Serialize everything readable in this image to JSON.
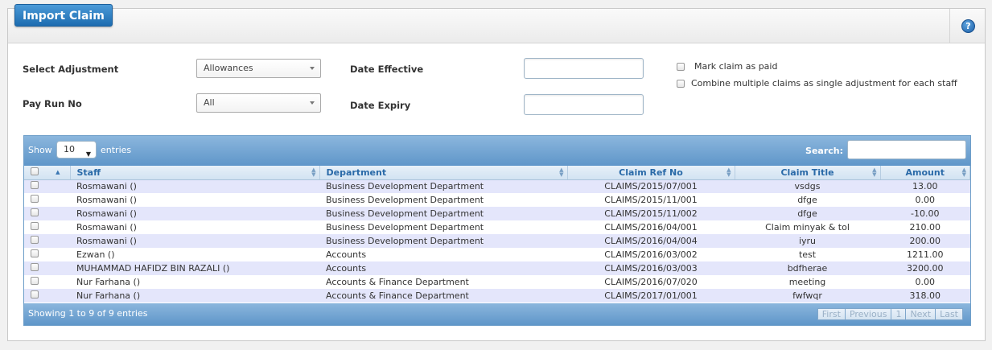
{
  "panel": {
    "title": "Import Claim",
    "help_icon": "?"
  },
  "form": {
    "select_adjustment": {
      "label": "Select Adjustment",
      "value": "Allowances"
    },
    "pay_run_no": {
      "label": "Pay Run No",
      "value": "All"
    },
    "date_effective": {
      "label": "Date Effective",
      "value": ""
    },
    "date_expiry": {
      "label": "Date Expiry",
      "value": ""
    },
    "mark_paid": {
      "label": "Mark claim as paid"
    },
    "combine": {
      "label": "Combine multiple claims as single adjustment for each staff"
    }
  },
  "table": {
    "show_label": "Show",
    "entries_label": "entries",
    "length_value": "10",
    "search_label": "Search:",
    "columns": {
      "staff": "Staff",
      "department": "Department",
      "ref": "Claim Ref No",
      "title": "Claim Title",
      "amount": "Amount"
    },
    "rows": [
      {
        "staff": "Rosmawani ()",
        "department": "Business Development Department",
        "ref": "CLAIMS/2015/07/001",
        "title": "vsdgs",
        "amount": "13.00"
      },
      {
        "staff": "Rosmawani ()",
        "department": "Business Development Department",
        "ref": "CLAIMS/2015/11/001",
        "title": "dfge",
        "amount": "0.00"
      },
      {
        "staff": "Rosmawani ()",
        "department": "Business Development Department",
        "ref": "CLAIMS/2015/11/002",
        "title": "dfge",
        "amount": "-10.00"
      },
      {
        "staff": "Rosmawani ()",
        "department": "Business Development Department",
        "ref": "CLAIMS/2016/04/001",
        "title": "Claim minyak & tol",
        "amount": "210.00"
      },
      {
        "staff": "Rosmawani ()",
        "department": "Business Development Department",
        "ref": "CLAIMS/2016/04/004",
        "title": "iyru",
        "amount": "200.00"
      },
      {
        "staff": "Ezwan ()",
        "department": "Accounts",
        "ref": "CLAIMS/2016/03/002",
        "title": "test",
        "amount": "1211.00"
      },
      {
        "staff": "MUHAMMAD HAFIDZ BIN RAZALI ()",
        "department": "Accounts",
        "ref": "CLAIMS/2016/03/003",
        "title": "bdfherae",
        "amount": "3200.00"
      },
      {
        "staff": "Nur Farhana ()",
        "department": "Accounts & Finance Department",
        "ref": "CLAIMS/2016/07/020",
        "title": "meeting",
        "amount": "0.00"
      },
      {
        "staff": "Nur Farhana ()",
        "department": "Accounts & Finance Department",
        "ref": "CLAIMS/2017/01/001",
        "title": "fwfwqr",
        "amount": "318.00"
      }
    ],
    "info": "Showing 1 to 9 of 9 entries",
    "pager": {
      "first": "First",
      "previous": "Previous",
      "page": "1",
      "next": "Next",
      "last": "Last"
    }
  }
}
